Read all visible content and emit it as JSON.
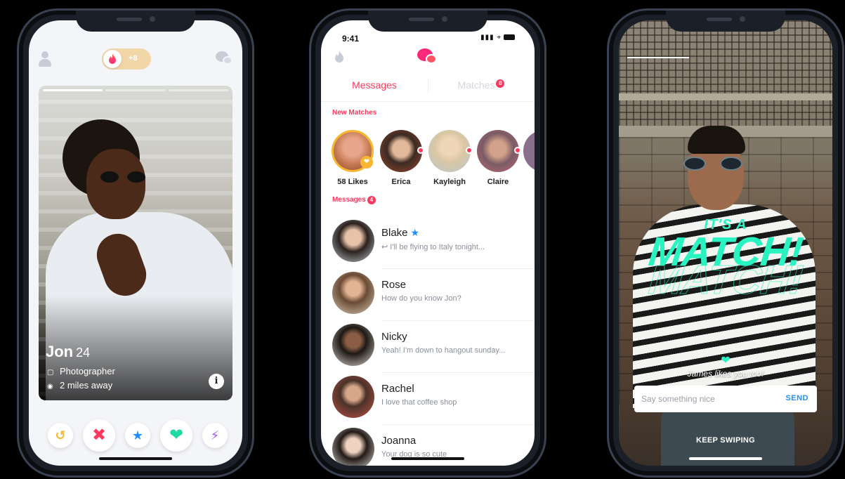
{
  "colors": {
    "brand_pink": "#fd3a5c",
    "brand_gradient_start": "#fd297b",
    "brand_gradient_end": "#ff655b",
    "match_teal": "#29f3c0",
    "send_blue": "#2a8ef0",
    "star_blue": "#1e8fff",
    "superlike_gold": "#f7b733"
  },
  "phone1": {
    "boost_count": "+8",
    "profile": {
      "name": "Jon",
      "age": "24",
      "job": "Photographer",
      "distance": "2 miles away",
      "photo_count": 3,
      "current_photo": 1
    },
    "actions": [
      {
        "name": "rewind",
        "icon": "rewind-icon",
        "color": "#f7b733"
      },
      {
        "name": "nope",
        "icon": "close-icon",
        "color": "#fd3a5c"
      },
      {
        "name": "super-like",
        "icon": "star-icon",
        "color": "#1e8fff"
      },
      {
        "name": "like",
        "icon": "heart-icon",
        "color": "#21d9a2"
      },
      {
        "name": "boost",
        "icon": "lightning-icon",
        "color": "#a259ff"
      }
    ]
  },
  "phone2": {
    "status_time": "9:41",
    "tabs": {
      "messages": "Messages",
      "matches": "Matches",
      "matches_badge": "8"
    },
    "new_matches_label": "New Matches",
    "new_matches": [
      {
        "name": "58 Likes",
        "likes": true
      },
      {
        "name": "Erica"
      },
      {
        "name": "Kayleigh"
      },
      {
        "name": "Claire"
      }
    ],
    "messages_label": "Messages",
    "messages_badge": "4",
    "messages": [
      {
        "name": "Blake",
        "text": "I'll be flying to Italy tonight...",
        "reply": true,
        "superlike": true
      },
      {
        "name": "Rose",
        "text": "How do you know Jon?"
      },
      {
        "name": "Nicky",
        "text": "Yeah! I'm down to hangout sunday..."
      },
      {
        "name": "Rachel",
        "text": "I love that coffee shop"
      },
      {
        "name": "Joanna",
        "text": "Your dog is so cute"
      }
    ]
  },
  "phone3": {
    "its_a": "IT'S A",
    "match": "MATCH!",
    "likes_text": "James likes you too!",
    "input_placeholder": "Say something nice",
    "send_label": "SEND",
    "keep_swiping": "KEEP SWIPING"
  }
}
